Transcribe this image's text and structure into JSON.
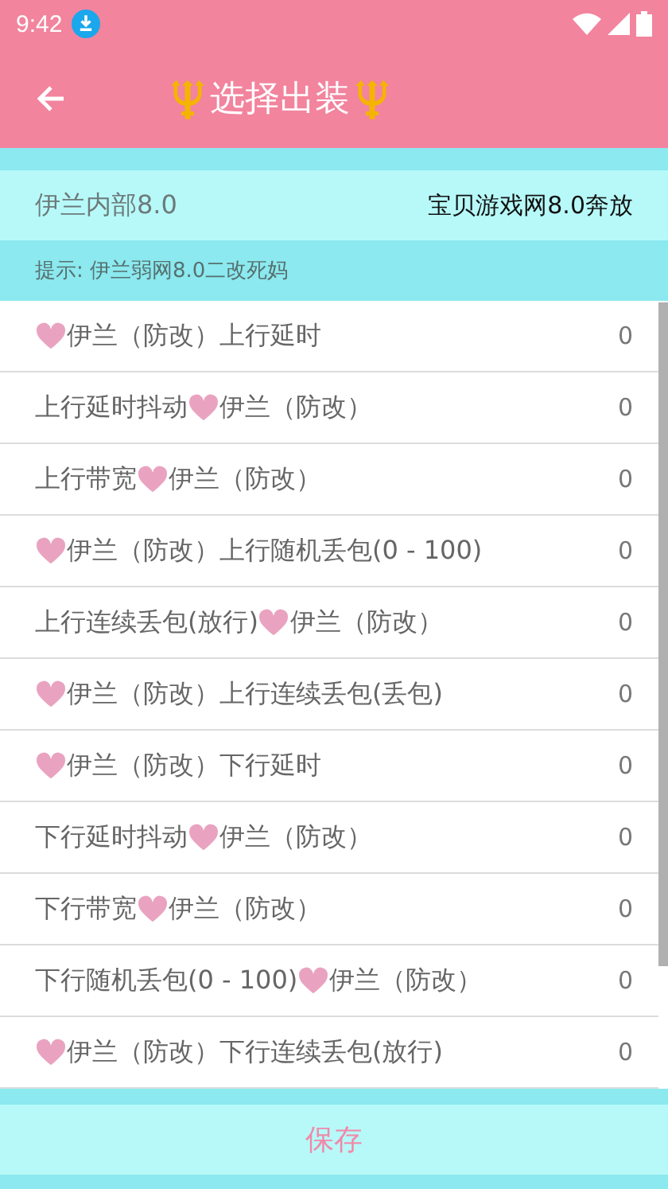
{
  "status_bar": {
    "time": "9:42"
  },
  "toolbar": {
    "title": "选择出装"
  },
  "field": {
    "label": "伊兰内部8.0",
    "value": "宝贝游戏网8.0奔放"
  },
  "hint": "提示: 伊兰弱网8.0二改死妈",
  "items": [
    {
      "after": "伊兰（防改）上行延时",
      "value": "0"
    },
    {
      "before": "上行延时抖动",
      "after": "伊兰（防改）",
      "value": "0"
    },
    {
      "before": "上行带宽",
      "after": "伊兰（防改）",
      "value": "0"
    },
    {
      "after": "伊兰（防改）上行随机丢包(0 - 100)",
      "value": "0"
    },
    {
      "before": "上行连续丢包(放行)",
      "after": "伊兰（防改）",
      "value": "0"
    },
    {
      "after": "伊兰（防改）上行连续丢包(丢包)",
      "value": "0"
    },
    {
      "after": "伊兰（防改）下行延时",
      "value": "0"
    },
    {
      "before": "下行延时抖动",
      "after": "伊兰（防改）",
      "value": "0"
    },
    {
      "before": "下行带宽",
      "after": "伊兰（防改）",
      "value": "0"
    },
    {
      "before": "下行随机丢包(0 - 100)",
      "after": "伊兰（防改）",
      "value": "0"
    },
    {
      "after": "伊兰（防改）下行连续丢包(放行)",
      "value": "0"
    }
  ],
  "save_button": "保存"
}
